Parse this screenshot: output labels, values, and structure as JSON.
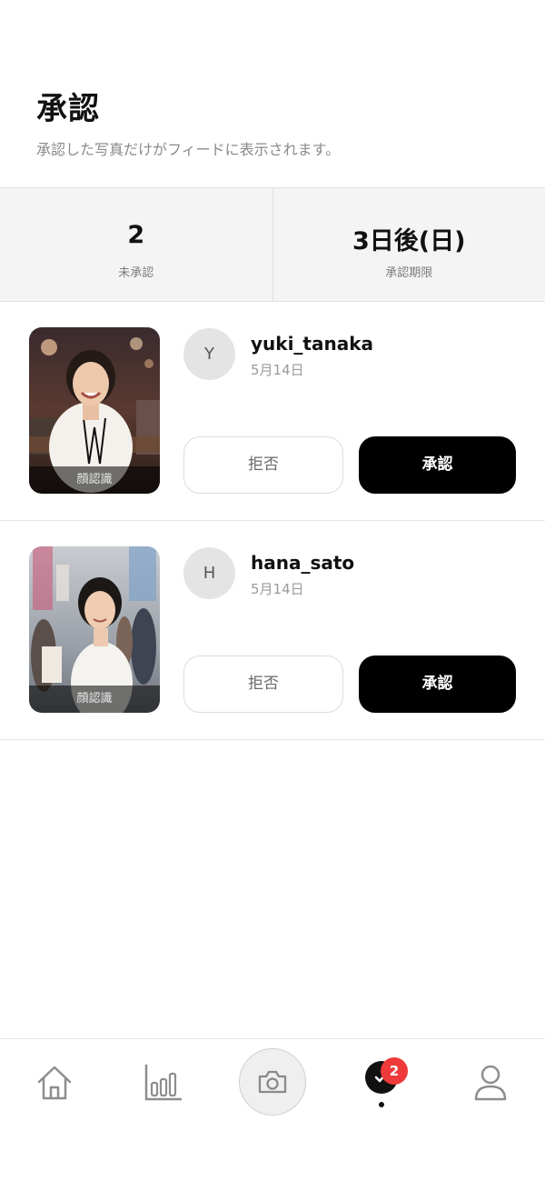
{
  "header": {
    "title": "承認",
    "subtitle": "承認した写真だけがフィードに表示されます。"
  },
  "stats": [
    {
      "value": "2",
      "label": "未承認"
    },
    {
      "value": "3日後(日)",
      "label": "承認期限"
    }
  ],
  "requests": [
    {
      "avatar_initial": "Y",
      "username": "yuki_tanaka",
      "date": "5月14日",
      "face_badge": "顔認識",
      "reject_label": "拒否",
      "approve_label": "承認"
    },
    {
      "avatar_initial": "H",
      "username": "hana_sato",
      "date": "5月14日",
      "face_badge": "顔認識",
      "reject_label": "拒否",
      "approve_label": "承認"
    }
  ],
  "tabbar": {
    "items": [
      {
        "icon": "home-icon"
      },
      {
        "icon": "bar-chart-icon"
      },
      {
        "icon": "camera-icon"
      },
      {
        "icon": "check-circle-icon",
        "active": true,
        "badge": "2"
      },
      {
        "icon": "profile-icon"
      }
    ]
  },
  "colors": {
    "primary": "#000000",
    "badge": "#ee3a3a",
    "stats_bg": "#f4f4f4"
  }
}
